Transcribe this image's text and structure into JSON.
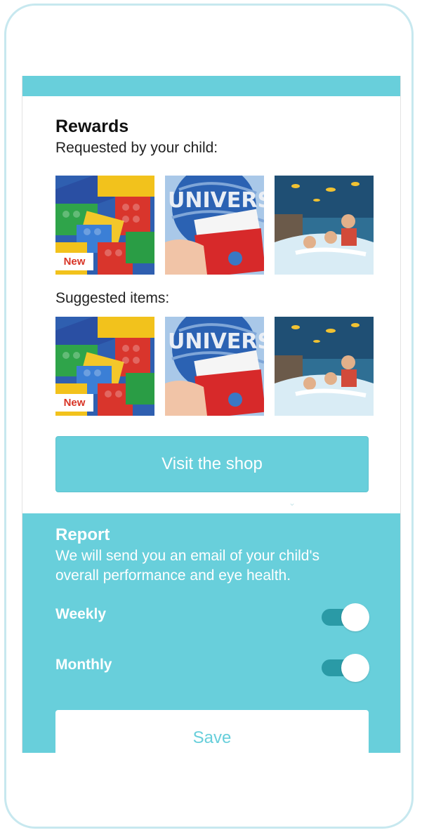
{
  "rewards": {
    "title": "Rewards",
    "requested_label": "Requested by your child:",
    "suggested_label": "Suggested items:",
    "new_badge": "New",
    "requested_items": [
      "lego-bricks-image",
      "universal-studios-tickets-image",
      "aquarium-water-park-image"
    ],
    "suggested_items": [
      "lego-bricks-image",
      "universal-studios-tickets-image",
      "aquarium-water-park-image"
    ],
    "universal_sign": "UNIVERS",
    "shop_button": "Visit the shop"
  },
  "report": {
    "title": "Report",
    "description": "We will send you an email of your child's overall performance and eye health.",
    "weekly_label": "Weekly",
    "weekly_enabled": true,
    "monthly_label": "Monthly",
    "monthly_enabled": true,
    "save_button": "Save"
  },
  "colors": {
    "accent": "#68cfdb",
    "toggle_track": "#2a9aa6",
    "badge_text": "#d83526"
  }
}
